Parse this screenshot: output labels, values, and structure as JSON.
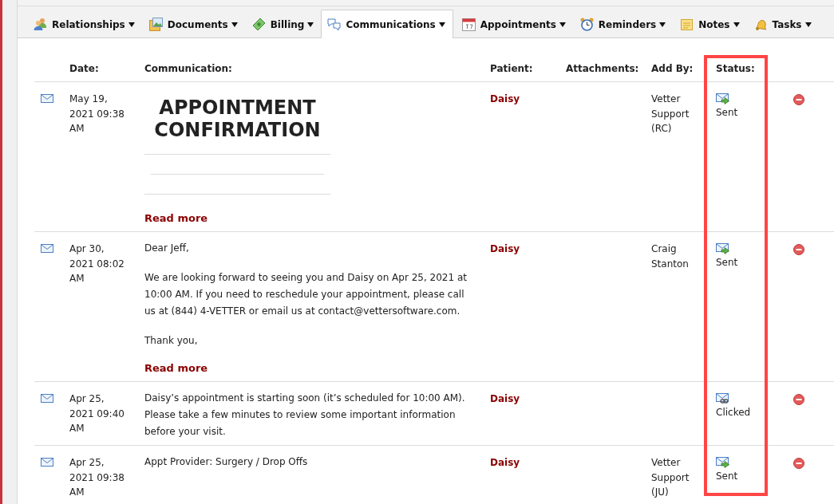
{
  "tabs": [
    {
      "label": "Relationships",
      "selected": false
    },
    {
      "label": "Documents",
      "selected": false
    },
    {
      "label": "Billing",
      "selected": false
    },
    {
      "label": "Communications",
      "selected": true
    },
    {
      "label": "Appointments",
      "selected": false
    },
    {
      "label": "Reminders",
      "selected": false
    },
    {
      "label": "Notes",
      "selected": false
    },
    {
      "label": "Tasks",
      "selected": false
    }
  ],
  "table": {
    "columns": [
      {
        "label": "Date:",
        "highlighted": false
      },
      {
        "label": "Communication:",
        "highlighted": false
      },
      {
        "label": "Patient:",
        "highlighted": false
      },
      {
        "label": "Attachments:",
        "highlighted": false
      },
      {
        "label": "Add By:",
        "highlighted": false
      },
      {
        "label": "Status:",
        "highlighted": true
      }
    ],
    "rows": [
      {
        "date": "May 19, 2021 09:38 AM",
        "communication": {
          "kind": "email_preview",
          "heading": "APPOINTMENT CONFIRMATION",
          "read_more": "Read more"
        },
        "patient": "Daisy",
        "added_by": "Vetter Support (RC)",
        "status": {
          "kind": "sent",
          "label": "Sent"
        }
      },
      {
        "date": "Apr 30, 2021 08:02 AM",
        "communication": {
          "kind": "text",
          "paragraphs": [
            "Dear Jeff,",
            "We are looking forward to seeing you and Daisy on Apr 25, 2021 at 10:00 AM. If you need to reschedule your appointment, please call us at (844) 4-VETTER or email us at contact@vettersoftware.com.",
            "Thank you,"
          ],
          "read_more": "Read more"
        },
        "patient": "Daisy",
        "added_by": "Craig Stanton",
        "status": {
          "kind": "sent",
          "label": "Sent"
        }
      },
      {
        "date": "Apr 25, 2021 09:40 AM",
        "communication": {
          "kind": "text",
          "paragraphs": [
            "Daisy’s appointment is starting soon (it’s scheduled for 10:00 AM). Please take a few minutes to review some important information before your visit."
          ]
        },
        "patient": "Daisy",
        "status": {
          "kind": "clicked",
          "label": "Clicked"
        }
      },
      {
        "date": "Apr 25, 2021 09:38 AM",
        "communication": {
          "kind": "text",
          "paragraphs": [
            "Appt Provider: Surgery / Drop Offs"
          ]
        },
        "patient": "Daisy",
        "added_by": "Vetter Support (JU)",
        "status": {
          "kind": "sent",
          "label": "Sent"
        }
      }
    ]
  }
}
